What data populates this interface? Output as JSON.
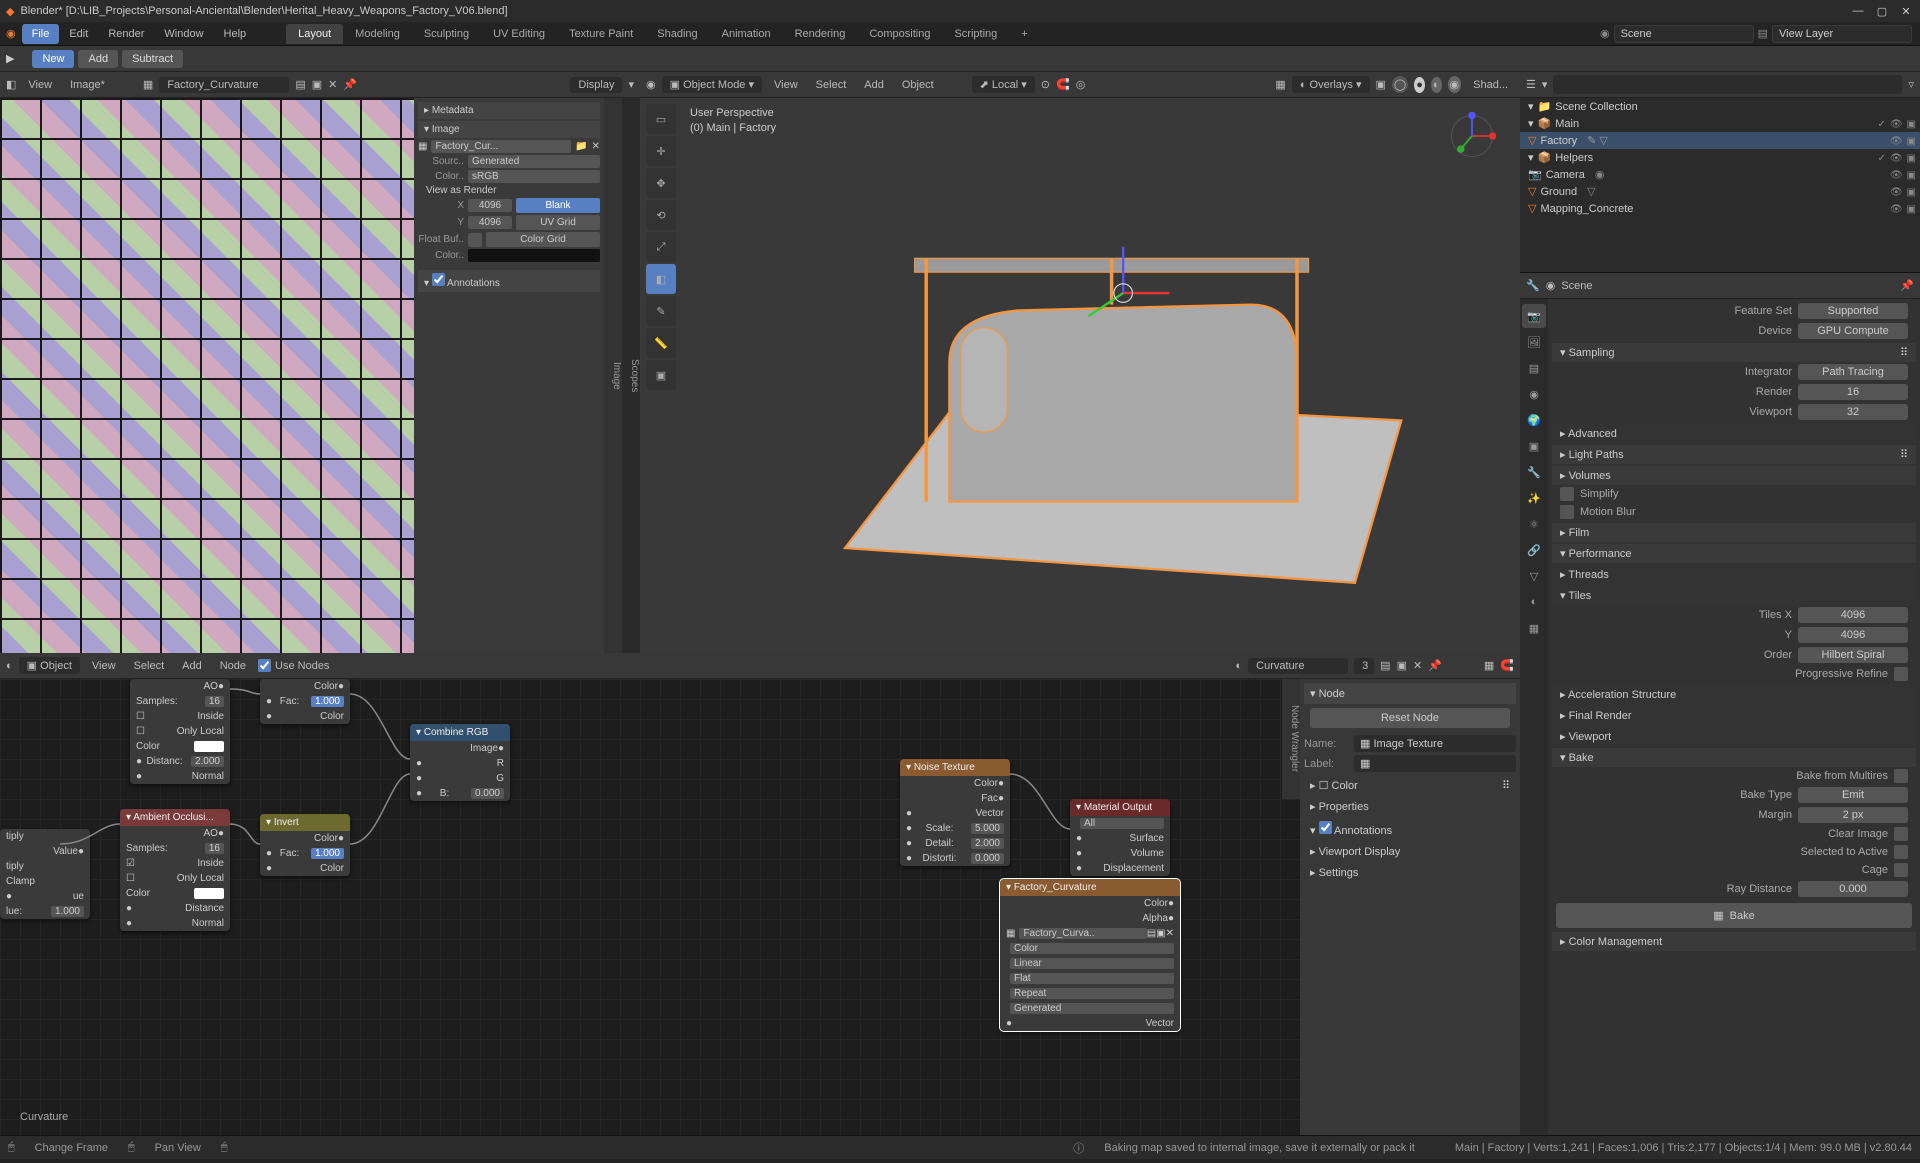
{
  "app": {
    "title": "Blender* [D:\\LIB_Projects\\Personal-Anciental\\Blender\\Herital_Heavy_Weapons_Factory_V06.blend]"
  },
  "menu": {
    "items": [
      "File",
      "Edit",
      "Render",
      "Window",
      "Help"
    ],
    "tabs": [
      "Layout",
      "Modeling",
      "Sculpting",
      "UV Editing",
      "Texture Paint",
      "Shading",
      "Animation",
      "Rendering",
      "Compositing",
      "Scripting"
    ],
    "active_tab": 0,
    "scene_label": "Scene",
    "viewlayer_label": "View Layer"
  },
  "toolbar2": {
    "new": "New",
    "add": "Add",
    "subtract": "Subtract"
  },
  "uv": {
    "view": "View",
    "image": "Image*",
    "image_name": "Factory_Curvature",
    "display": "Display",
    "panel": {
      "metadata": "Metadata",
      "image_hdr": "Image",
      "image_field": "Factory_Cur...",
      "source_lbl": "Sourc..",
      "source_val": "Generated",
      "color_lbl": "Color..",
      "color_val": "sRGB",
      "view_as_render": "View as Render",
      "x_lbl": "X",
      "x": "4096",
      "y_lbl": "Y",
      "y": "4096",
      "blank": "Blank",
      "uvgrid": "UV Grid",
      "colorgrid": "Color Grid",
      "floatbuf": "Float Buf..",
      "color2": "Color..",
      "annotations": "Annotations"
    },
    "vtabs": {
      "image": "Image",
      "scopes": "Scopes"
    }
  },
  "vp3d": {
    "mode": "Object Mode",
    "view": "View",
    "select": "Select",
    "add": "Add",
    "object": "Object",
    "orient": "Local",
    "overlays": "Overlays",
    "shading": "Shad...",
    "persp": "User Perspective",
    "context": "(0) Main | Factory"
  },
  "node": {
    "obj": "Object",
    "view": "View",
    "select": "Select",
    "add": "Add",
    "node_menu": "Node",
    "use_nodes": "Use Nodes",
    "material": "Curvature",
    "mat_users": "3",
    "panel": {
      "hdr": "Node",
      "reset": "Reset Node",
      "name_lbl": "Name:",
      "name": "Image Texture",
      "label_lbl": "Label:",
      "label": "",
      "color": "Color",
      "properties": "Properties",
      "annotations": "Annotations",
      "viewport_display": "Viewport Display",
      "settings": "Settings"
    },
    "vtab": "Node Wrangler",
    "breadcrumb": "Curvature",
    "nodes": {
      "ao1": {
        "hdr": "",
        "ao": "AO",
        "samples": "Samples:",
        "samples_v": "16",
        "inside": "Inside",
        "only_local": "Only Local",
        "color": "Color",
        "distance": "Distanc:",
        "distance_v": "2.000",
        "normal": "Normal"
      },
      "ao2": {
        "hdr": "Ambient Occlusi...",
        "ao": "AO",
        "samples": "Samples:",
        "samples_v": "16",
        "inside": "Inside",
        "only_local": "Only Local",
        "color": "Color",
        "distance": "Distance",
        "normal": "Normal"
      },
      "math": {
        "tply": "tiply",
        "val": "Value",
        "tiply": "tiply",
        "clamp": "Clamp",
        "ue": "ue",
        "lue": "lue:",
        "lue_v": "1.000"
      },
      "inv1": {
        "hdr": "",
        "color": "Color",
        "fac": "Fac:",
        "fac_v": "1.000",
        "color2": "Color"
      },
      "inv2": {
        "hdr": "Invert",
        "color": "Color",
        "fac": "Fac:",
        "fac_v": "1.000",
        "color2": "Color"
      },
      "comb": {
        "hdr": "Combine RGB",
        "image": "Image",
        "r": "R",
        "g": "G",
        "b": "B:",
        "b_v": "0.000"
      },
      "noise": {
        "hdr": "Noise Texture",
        "color": "Color",
        "fac": "Fac",
        "vector": "Vector",
        "scale": "Scale:",
        "scale_v": "5.000",
        "detail": "Detail:",
        "detail_v": "2.000",
        "distort": "Distorti:",
        "distort_v": "0.000"
      },
      "matout": {
        "hdr": "Material Output",
        "all": "All",
        "surface": "Surface",
        "volume": "Volume",
        "disp": "Displacement"
      },
      "imgtex": {
        "hdr": "Factory_Curvature",
        "color": "Color",
        "alpha": "Alpha",
        "img": "Factory_Curva..",
        "s1": "Color",
        "s2": "Linear",
        "s3": "Flat",
        "s4": "Repeat",
        "s5": "Generated",
        "vector": "Vector"
      }
    }
  },
  "outliner": {
    "items": [
      {
        "label": "Scene Collection",
        "depth": 0,
        "exp": "▾"
      },
      {
        "label": "Main",
        "depth": 1,
        "exp": "▾"
      },
      {
        "label": "Factory",
        "depth": 2,
        "sel": true,
        "mesh": true
      },
      {
        "label": "Helpers",
        "depth": 1,
        "exp": "▾"
      },
      {
        "label": "Camera",
        "depth": 2,
        "cam": true
      },
      {
        "label": "Ground",
        "depth": 2,
        "mesh": true
      },
      {
        "label": "Mapping_Concrete",
        "depth": 2
      }
    ]
  },
  "props": {
    "scene_hdr": "Scene",
    "feature_set_lbl": "Feature Set",
    "feature_set": "Supported",
    "device_lbl": "Device",
    "device": "GPU Compute",
    "sampling": "Sampling",
    "integrator_lbl": "Integrator",
    "integrator": "Path Tracing",
    "render_lbl": "Render",
    "render": "16",
    "viewport_lbl": "Viewport",
    "viewport": "32",
    "advanced": "Advanced",
    "light_paths": "Light Paths",
    "volumes": "Volumes",
    "simplify": "Simplify",
    "motion_blur": "Motion Blur",
    "film": "Film",
    "performance": "Performance",
    "threads": "Threads",
    "tiles": "Tiles",
    "tiles_x_lbl": "Tiles X",
    "tiles_x": "4096",
    "tiles_y_lbl": "Y",
    "tiles_y": "4096",
    "order_lbl": "Order",
    "order": "Hilbert Spiral",
    "prog_refine": "Progressive Refine",
    "accel": "Acceleration Structure",
    "final_render": "Final Render",
    "viewport2": "Viewport",
    "bake": "Bake",
    "bake_multires": "Bake from Multires",
    "bake_type_lbl": "Bake Type",
    "bake_type": "Emit",
    "margin_lbl": "Margin",
    "margin": "2 px",
    "clear_image": "Clear Image",
    "sel_to_active": "Selected to Active",
    "cage": "Cage",
    "ray_dist_lbl": "Ray Distance",
    "ray_dist": "0.000",
    "bake_btn": "Bake",
    "color_mgmt": "Color Management"
  },
  "status": {
    "left1": "Change Frame",
    "left2": "Pan View",
    "mid": "Baking map saved to internal image, save it externally or pack it",
    "right": "Main | Factory | Verts:1,241 | Faces:1,006 | Tris:2,177 | Objects:1/4 | Mem: 99.0 MB | v2.80.44"
  }
}
